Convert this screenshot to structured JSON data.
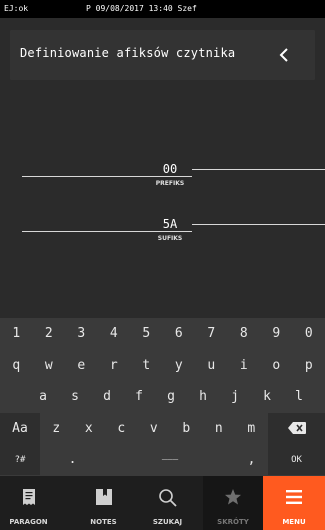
{
  "status": {
    "left": "EJ:ok",
    "center": "P 09/08/2017  13:40  Szef"
  },
  "header": {
    "title": "Definiowanie afiksów czytnika",
    "back_glyph": "<"
  },
  "fields": {
    "prefix": {
      "value": "00",
      "label": "PREFIKS"
    },
    "suffix": {
      "value": "5A",
      "label": "SUFIKS"
    }
  },
  "keyboard": {
    "row1": [
      "1",
      "2",
      "3",
      "4",
      "5",
      "6",
      "7",
      "8",
      "9",
      "0"
    ],
    "row2": [
      "q",
      "w",
      "e",
      "r",
      "t",
      "y",
      "u",
      "i",
      "o",
      "p"
    ],
    "row3": [
      "a",
      "s",
      "d",
      "f",
      "g",
      "h",
      "j",
      "k",
      "l"
    ],
    "row4": [
      "z",
      "x",
      "c",
      "v",
      "b",
      "n",
      "m"
    ],
    "shift_label": "Aa",
    "backspace_icon": "backspace-icon",
    "symbols_label": "?#",
    "period_label": ".",
    "space_label": "———",
    "comma_label": ",",
    "ok_label": "OK"
  },
  "nav": {
    "paragon": "PARAGON",
    "notes": "NOTES",
    "szukaj": "SZUKAJ",
    "skroty": "SKRÓTY",
    "menu": "MENU"
  },
  "colors": {
    "accent": "#ff5a1f",
    "background": "#2b2b2b",
    "keyboard": "#3a3a3a"
  }
}
